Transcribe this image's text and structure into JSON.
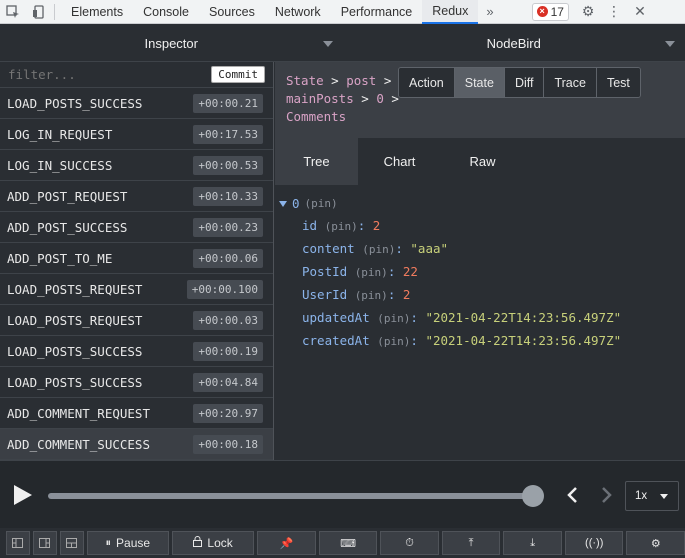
{
  "devtools": {
    "tabs": [
      "Elements",
      "Console",
      "Sources",
      "Network",
      "Performance",
      "Redux"
    ],
    "active_tab": "Redux",
    "more": "»",
    "error_count": "17"
  },
  "header": {
    "left_title": "Inspector",
    "right_title": "NodeBird"
  },
  "filter": {
    "placeholder": "filter...",
    "commit_label": "Commit"
  },
  "actions": [
    {
      "name": "LOAD_POSTS_SUCCESS",
      "time": "+00:00.21"
    },
    {
      "name": "LOG_IN_REQUEST",
      "time": "+00:17.53"
    },
    {
      "name": "LOG_IN_SUCCESS",
      "time": "+00:00.53"
    },
    {
      "name": "ADD_POST_REQUEST",
      "time": "+00:10.33"
    },
    {
      "name": "ADD_POST_SUCCESS",
      "time": "+00:00.23"
    },
    {
      "name": "ADD_POST_TO_ME",
      "time": "+00:00.06"
    },
    {
      "name": "LOAD_POSTS_REQUEST",
      "time": "+00:00.100"
    },
    {
      "name": "LOAD_POSTS_REQUEST",
      "time": "+00:00.03"
    },
    {
      "name": "LOAD_POSTS_SUCCESS",
      "time": "+00:00.19"
    },
    {
      "name": "LOAD_POSTS_SUCCESS",
      "time": "+00:04.84"
    },
    {
      "name": "ADD_COMMENT_REQUEST",
      "time": "+00:20.97"
    },
    {
      "name": "ADD_COMMENT_SUCCESS",
      "time": "+00:00.18"
    }
  ],
  "breadcrumb": {
    "items": [
      "State",
      "post",
      "mainPosts",
      "0",
      "Comments"
    ],
    "sep": ">"
  },
  "view_tabs": [
    "Action",
    "State",
    "Diff",
    "Trace",
    "Test"
  ],
  "active_view_tab": "State",
  "sub_tabs": [
    "Tree",
    "Chart",
    "Raw"
  ],
  "active_sub_tab": "Tree",
  "tree": {
    "root_key": "0",
    "pin": "(pin)",
    "rows": [
      {
        "key": "id",
        "value": "2",
        "kind": "num"
      },
      {
        "key": "content",
        "value": "\"aaa\"",
        "kind": "str"
      },
      {
        "key": "PostId",
        "value": "22",
        "kind": "num"
      },
      {
        "key": "UserId",
        "value": "2",
        "kind": "num"
      },
      {
        "key": "updatedAt",
        "value": "\"2021-04-22T14:23:56.497Z\"",
        "kind": "str"
      },
      {
        "key": "createdAt",
        "value": "\"2021-04-22T14:23:56.497Z\"",
        "kind": "str"
      }
    ]
  },
  "player": {
    "speed": "1x",
    "progress": 1.0
  },
  "toolbar": {
    "pause_label": "Pause",
    "lock_label": "Lock"
  }
}
